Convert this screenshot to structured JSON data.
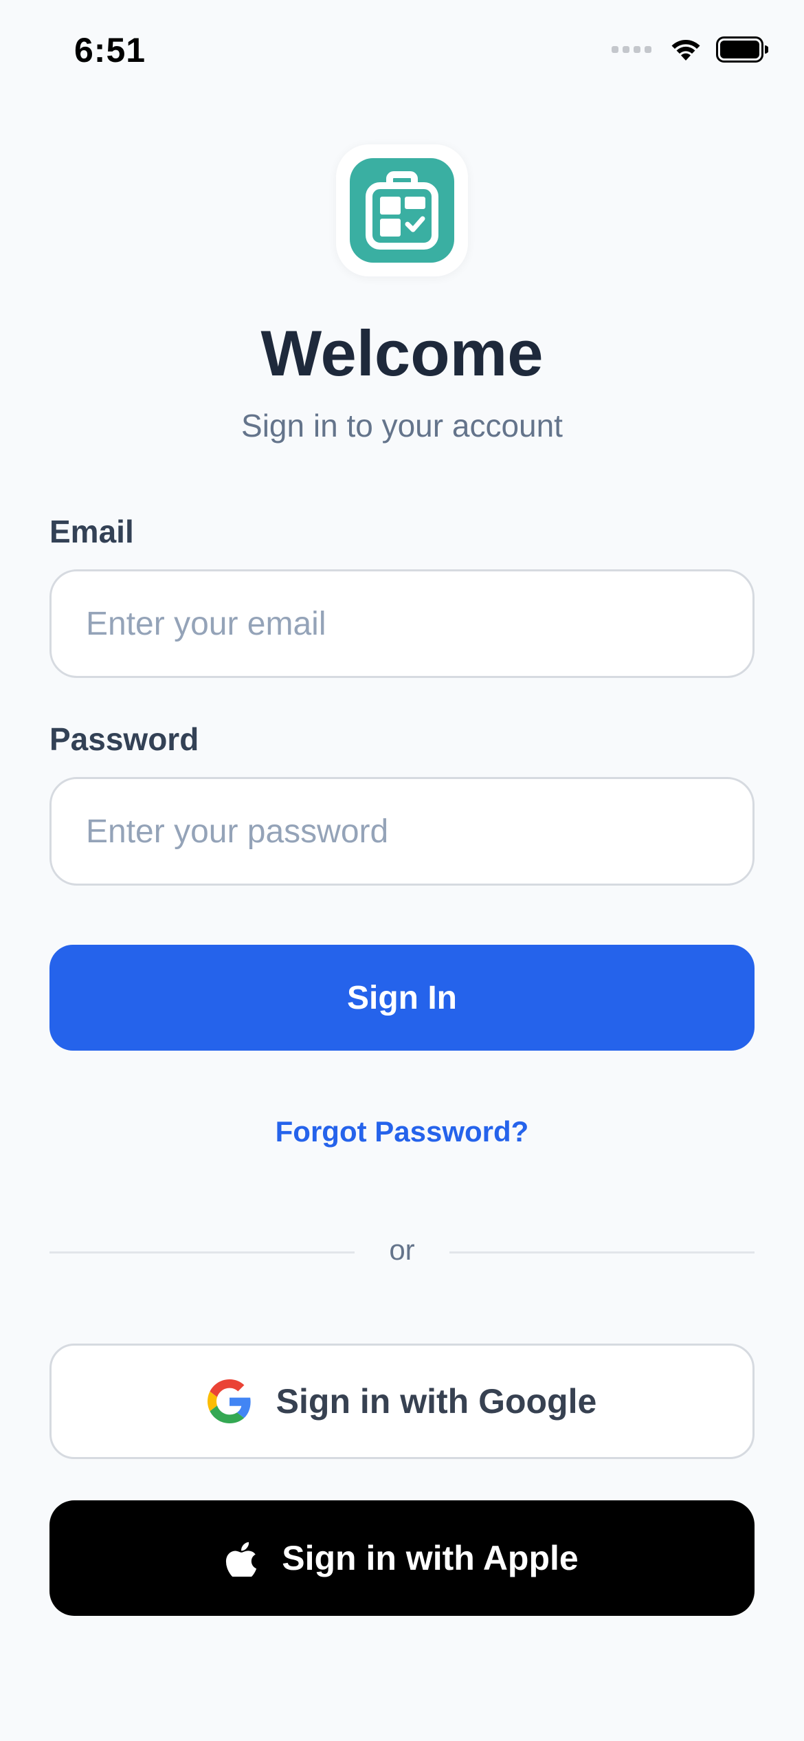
{
  "status_bar": {
    "time": "6:51",
    "icons": [
      "cellular-signal-icon",
      "wifi-icon",
      "battery-icon"
    ]
  },
  "app_icon": {
    "name": "briefcase-checklist-icon",
    "color": "#3aafa2"
  },
  "header": {
    "title": "Welcome",
    "subtitle": "Sign in to your account"
  },
  "form": {
    "email_label": "Email",
    "email_placeholder": "Enter your email",
    "email_value": "",
    "password_label": "Password",
    "password_placeholder": "Enter your password",
    "password_value": "",
    "sign_in_label": "Sign In",
    "forgot_password_label": "Forgot Password?"
  },
  "divider": {
    "text": "or"
  },
  "social": {
    "google_label": "Sign in with Google",
    "apple_label": "Sign in with Apple"
  },
  "colors": {
    "background": "#f8fafc",
    "primary": "#2563eb",
    "brand_teal": "#3aafa2",
    "apple_button": "#000000"
  }
}
